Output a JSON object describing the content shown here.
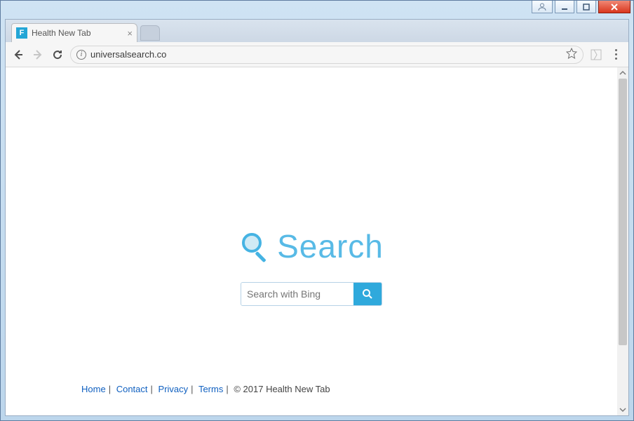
{
  "tab": {
    "title": "Health New Tab",
    "favicon_letter": "F"
  },
  "addressbar": {
    "url": "universalsearch.co"
  },
  "page": {
    "brand": "Search",
    "search_placeholder": "Search with Bing"
  },
  "footer": {
    "links": [
      "Home",
      "Contact",
      "Privacy",
      "Terms"
    ],
    "copyright": "© 2017 Health New Tab"
  }
}
